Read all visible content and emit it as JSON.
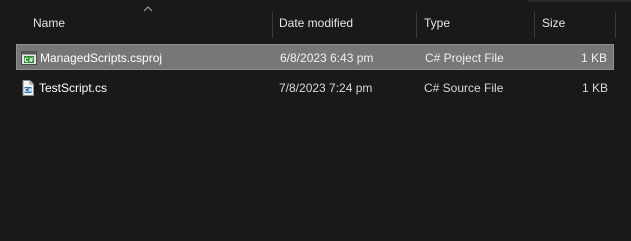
{
  "columns": {
    "name": "Name",
    "date_modified": "Date modified",
    "type": "Type",
    "size": "Size"
  },
  "sort": {
    "column": "name",
    "direction": "ascending",
    "icon": "chevron-up-icon"
  },
  "files": [
    {
      "name": "ManagedScripts.csproj",
      "date_modified": "6/8/2023 6:43 pm",
      "type": "C# Project File",
      "size": "1 KB",
      "icon": "csproj-file-icon",
      "selected": true
    },
    {
      "name": "TestScript.cs",
      "date_modified": "7/8/2023 7:24 pm",
      "type": "C# Source File",
      "size": "1 KB",
      "icon": "cs-file-icon",
      "selected": false
    }
  ],
  "colors": {
    "background": "#191919",
    "selection": "#777777",
    "csproj_icon_accent": "#2e8b2e",
    "text": "#ffffff"
  }
}
